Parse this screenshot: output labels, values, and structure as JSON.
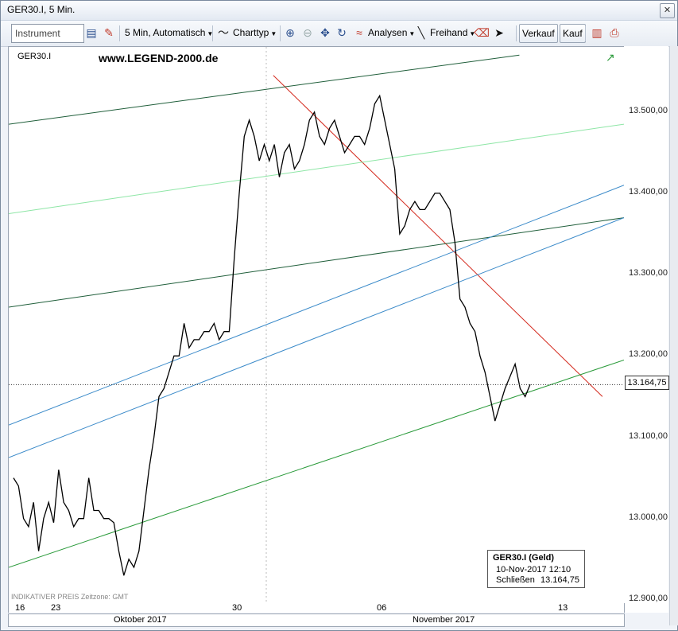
{
  "window": {
    "title": "GER30.I, 5 Min."
  },
  "toolbar": {
    "instrument_placeholder": "Instrument",
    "interval_label": "5 Min,  Automatisch",
    "charttyp_label": "Charttyp",
    "analysen_label": "Analysen",
    "freihand_label": "Freihand",
    "verkauf_label": "Verkauf",
    "kauf_label": "Kauf"
  },
  "chart_header": {
    "symbol": "GER30.I",
    "watermark": "www.LEGEND-2000.de",
    "footer": "INDIKATIVER PREIS   Zeitzone: GMT"
  },
  "current_price": "13.164,75",
  "info_box": {
    "title": "GER30.I (Geld)",
    "datetime": "10-Nov-2017 12:10",
    "close_label": "Schließen",
    "close_value": "13.164,75"
  },
  "colors": {
    "price": "#000000",
    "red_trend": "#d42a1e",
    "dark_green": "#1f5e3a",
    "light_green": "#8ee6a6",
    "blue": "#3a8ac9",
    "green": "#2a9a3a"
  },
  "chart_data": {
    "type": "line",
    "y_ticks": [
      "13.500,00",
      "13.400,00",
      "13.300,00",
      "13.200,00",
      "13.100,00",
      "13.000,00",
      "12.900,00"
    ],
    "x_ticks": [
      "16",
      "23",
      "30",
      "06",
      "13"
    ],
    "months": [
      "Oktober 2017",
      "November 2017"
    ],
    "ylim": [
      12895,
      13580
    ],
    "series": [
      {
        "values": [
          13050,
          13040,
          13000,
          12990,
          13020,
          12960,
          13000,
          13020,
          12995,
          13060,
          13020,
          13010,
          12990,
          13000,
          13000,
          13050,
          13010,
          13010,
          13000,
          13000,
          12995,
          12960,
          12930,
          12950,
          12940,
          12960,
          13010,
          13060,
          13100,
          13150,
          13160,
          13180,
          13200,
          13200,
          13240,
          13210,
          13220,
          13220,
          13230,
          13230,
          13240,
          13220,
          13230,
          13230,
          13320,
          13400,
          13470,
          13490,
          13470,
          13440,
          13460,
          13440,
          13460,
          13420,
          13450,
          13460,
          13430,
          13440,
          13460,
          13490,
          13500,
          13470,
          13460,
          13480,
          13490,
          13470,
          13450,
          13460,
          13470,
          13470,
          13460,
          13480,
          13510,
          13520,
          13490,
          13460,
          13430,
          13350,
          13360,
          13380,
          13390,
          13380,
          13380,
          13390,
          13400,
          13400,
          13390,
          13380,
          13340,
          13270,
          13260,
          13240,
          13230,
          13200,
          13180,
          13150,
          13120,
          13140,
          13160,
          13175,
          13190,
          13160,
          13150,
          13165
        ]
      }
    ],
    "trendlines": [
      {
        "color": "red_trend",
        "points": [
          [
            0.43,
            13545
          ],
          [
            0.965,
            13150
          ]
        ]
      },
      {
        "color": "dark_green",
        "points": [
          [
            0.0,
            13485
          ],
          [
            0.83,
            13570
          ]
        ]
      },
      {
        "color": "light_green",
        "points": [
          [
            0.0,
            13375
          ],
          [
            1.0,
            13485
          ]
        ]
      },
      {
        "color": "dark_green",
        "points": [
          [
            0.0,
            13260
          ],
          [
            1.0,
            13370
          ]
        ]
      },
      {
        "color": "blue",
        "points": [
          [
            0.0,
            13115
          ],
          [
            1.0,
            13410
          ]
        ]
      },
      {
        "color": "blue",
        "points": [
          [
            0.0,
            13075
          ],
          [
            1.0,
            13370
          ]
        ]
      },
      {
        "color": "green",
        "points": [
          [
            0.0,
            12940
          ],
          [
            1.0,
            13195
          ]
        ]
      }
    ]
  }
}
